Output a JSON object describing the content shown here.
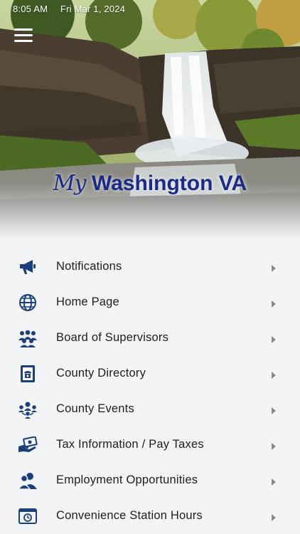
{
  "status_bar": {
    "time": "8:05 AM",
    "date": "Fri Mar 1, 2024"
  },
  "header": {
    "brand_my": "My",
    "brand_name": "Washington VA"
  },
  "colors": {
    "brand": "#1b2a86",
    "icon": "#1b3f78",
    "chevron": "#8a8a8a",
    "background": "#f3f4f6"
  },
  "menu": [
    {
      "label": "Notifications",
      "icon": "megaphone-icon"
    },
    {
      "label": "Home Page",
      "icon": "globe-icon"
    },
    {
      "label": "Board of Supervisors",
      "icon": "group-icon"
    },
    {
      "label": "County Directory",
      "icon": "phone-book-icon"
    },
    {
      "label": "County Events",
      "icon": "people-network-icon"
    },
    {
      "label": "Tax Information / Pay Taxes",
      "icon": "money-hand-icon"
    },
    {
      "label": "Employment Opportunities",
      "icon": "users-icon"
    },
    {
      "label": "Convenience Station Hours",
      "icon": "clock-window-icon"
    }
  ]
}
